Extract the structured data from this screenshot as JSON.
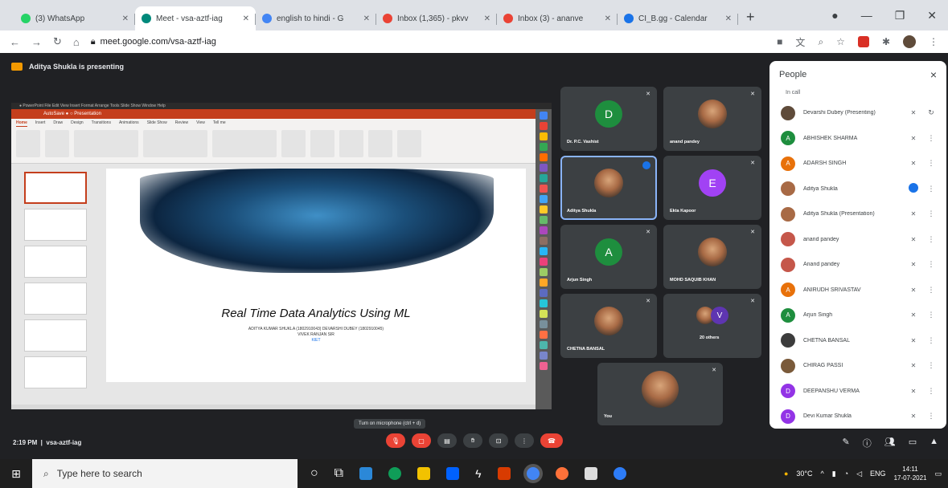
{
  "browser": {
    "tabs": [
      {
        "title": "(3) WhatsApp",
        "color": "#25d366"
      },
      {
        "title": "Meet - vsa-aztf-iag",
        "color": "#00897b"
      },
      {
        "title": "english to hindi - G",
        "color": "#4285f4"
      },
      {
        "title": "Inbox (1,365) - pkvv",
        "color": "#ea4335"
      },
      {
        "title": "Inbox (3) - ananve",
        "color": "#ea4335"
      },
      {
        "title": "CI_B.gg - Calendar",
        "color": "#1a73e8"
      }
    ],
    "new_tab": "+",
    "address": "meet.google.com/vsa-aztf-iag"
  },
  "meet": {
    "presenting_label": "Aditya Shukla is presenting",
    "meeting_time": "2:19 PM",
    "meeting_code": "vsa-aztf-iag",
    "tooltip": "Turn on microphone (ctrl + d)"
  },
  "slide": {
    "title": "Real Time Data Analytics Using ML",
    "authors": "ADITYA KUMAR SHUKLA (1802910043) DEVARSHI DUBEY (1802910045)",
    "guide": "VIVEK RANJAN SIR",
    "org": "KIET"
  },
  "tiles": [
    {
      "name": "Dr. P.C. Vashist",
      "initial": "D",
      "color": "#1e8e3e",
      "kind": "letter"
    },
    {
      "name": "anand pandey",
      "kind": "photo"
    },
    {
      "name": "Aditya Shukla",
      "kind": "photo",
      "speaking": true
    },
    {
      "name": "Ekta Kapoor",
      "initial": "E",
      "color": "#a142f4",
      "kind": "letter"
    },
    {
      "name": "Arjun Singh",
      "initial": "A",
      "color": "#1e8e3e",
      "kind": "letter"
    },
    {
      "name": "MOHD SAQUIB KHAN",
      "kind": "photo"
    },
    {
      "name": "CHETNA BANSAL",
      "kind": "photo"
    },
    {
      "name": "20 others",
      "initial": "V",
      "color": "#5e35b1",
      "kind": "others"
    },
    {
      "name": "You",
      "kind": "photo"
    }
  ],
  "people": {
    "title": "People",
    "subtitle": "In call",
    "close": "×",
    "list": [
      {
        "name": "Devarshi Dubey (Presenting)",
        "color": "#5f4b3a",
        "initial": ""
      },
      {
        "name": "ABHISHEK SHARMA",
        "color": "#1e8e3e",
        "initial": "A"
      },
      {
        "name": "ADARSH SINGH",
        "color": "#e8710a",
        "initial": "A"
      },
      {
        "name": "Aditya Shukla",
        "color": "#a86a45",
        "initial": "",
        "talking": true
      },
      {
        "name": "Aditya Shukla (Presentation)",
        "color": "#a86a45",
        "initial": ""
      },
      {
        "name": "anand pandey",
        "color": "#c5574a",
        "initial": ""
      },
      {
        "name": "Anand pandey",
        "color": "#c5574a",
        "initial": ""
      },
      {
        "name": "ANIRUDH SRIVASTAV",
        "color": "#e8710a",
        "initial": "A"
      },
      {
        "name": "Arjun Singh",
        "color": "#1e8e3e",
        "initial": "A"
      },
      {
        "name": "CHETNA BANSAL",
        "color": "#3c3c3c",
        "initial": ""
      },
      {
        "name": "CHIRAG PASSI",
        "color": "#7a5a3a",
        "initial": ""
      },
      {
        "name": "DEEPANSHU VERMA",
        "color": "#9334e6",
        "initial": "D"
      },
      {
        "name": "Devi Kumar Shukla",
        "color": "#9334e6",
        "initial": "D"
      }
    ]
  },
  "taskbar": {
    "search_placeholder": "Type here to search",
    "weather": "30°C",
    "lang": "ENG",
    "time": "14:11",
    "date": "17-07-2021"
  }
}
